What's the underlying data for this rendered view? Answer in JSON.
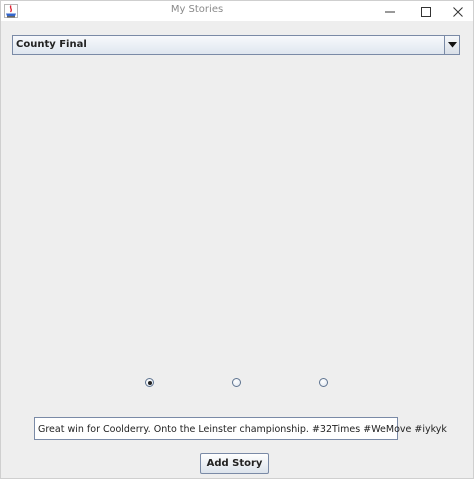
{
  "window": {
    "title": "My Stories",
    "controls": {
      "minimize": "minimize-icon",
      "maximize": "maximize-icon",
      "close": "close-icon"
    },
    "app_icon": "java-app-icon"
  },
  "story_select": {
    "selected": "County Final"
  },
  "radio_options": {
    "selected_index": 0,
    "count": 3
  },
  "story_input": {
    "value": "Great win for Coolderry. Onto the Leinster championship.  #32Times #WeMove #iykyk"
  },
  "add_button": {
    "label": "Add Story"
  },
  "colors": {
    "window_bg": "#eeeeee",
    "border": "#7a8aa6",
    "titlebar_bg": "#ffffff"
  }
}
